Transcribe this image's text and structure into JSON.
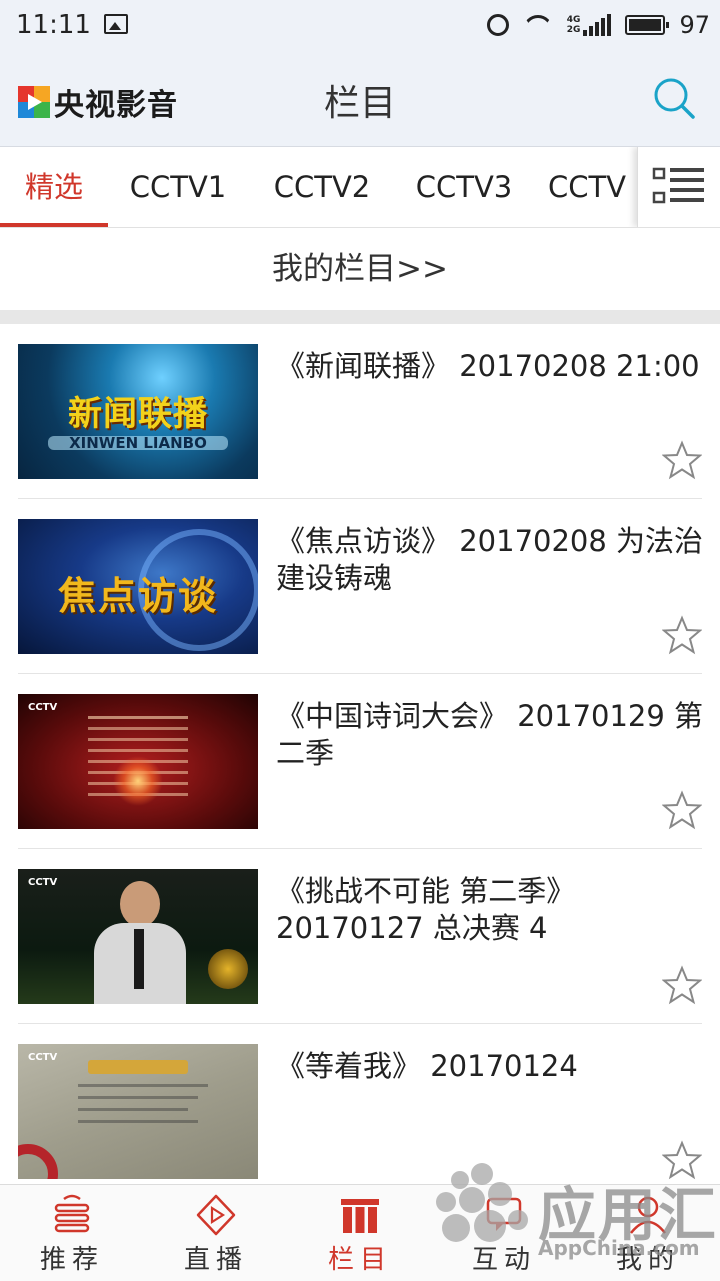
{
  "status_bar": {
    "time": "11:11",
    "battery": "97",
    "net_top": "4G",
    "net_bottom": "2G"
  },
  "header": {
    "app_name": "央视影音",
    "page_title": "栏目",
    "search_icon": "search-icon"
  },
  "tabs": [
    {
      "label": "精选",
      "active": true
    },
    {
      "label": "CCTV1",
      "active": false
    },
    {
      "label": "CCTV2",
      "active": false
    },
    {
      "label": "CCTV3",
      "active": false
    },
    {
      "label": "CCTV",
      "active": false
    }
  ],
  "my_columns_link": "我的栏目>>",
  "programs": [
    {
      "title": "《新闻联播》 20170208 21:00",
      "thumb_text": "新闻联播",
      "thumb_sub": "XINWEN LIANBO"
    },
    {
      "title": "《焦点访谈》 20170208 为法治建设铸魂",
      "thumb_text": "焦点访谈"
    },
    {
      "title": "《中国诗词大会》 20170129 第二季",
      "thumb_logo": "CCTV"
    },
    {
      "title": "《挑战不可能 第二季》 20170127 总决赛 4",
      "thumb_logo": "CCTV"
    },
    {
      "title": "《等着我》 20170124",
      "thumb_logo": "CCTV"
    }
  ],
  "bottom_nav": [
    {
      "label": "推荐",
      "icon": "recommend-icon",
      "active": false
    },
    {
      "label": "直播",
      "icon": "live-play-icon",
      "active": false
    },
    {
      "label": "栏目",
      "icon": "columns-icon",
      "active": true
    },
    {
      "label": "互动",
      "icon": "interact-icon",
      "active": false
    },
    {
      "label": "我的",
      "icon": "profile-icon",
      "active": false
    }
  ],
  "watermark": {
    "title": "应用汇",
    "subtitle": "AppChina.com"
  },
  "colors": {
    "accent": "#d0372b",
    "header_bg": "#eef2f8",
    "search": "#1aa3c8"
  }
}
